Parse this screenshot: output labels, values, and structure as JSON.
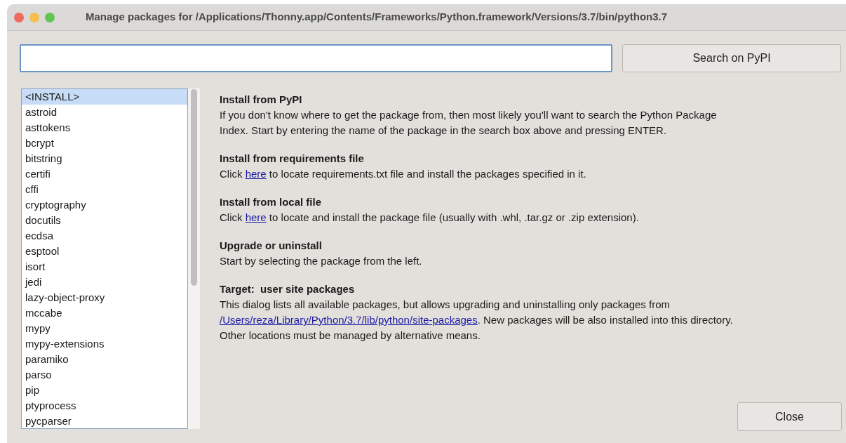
{
  "window": {
    "title": "Manage packages for /Applications/Thonny.app/Contents/Frameworks/Python.framework/Versions/3.7/bin/python3.7"
  },
  "search_button": "Search on PyPI",
  "packages": [
    {
      "label": "<INSTALL>",
      "selected": true
    },
    {
      "label": "astroid",
      "selected": false
    },
    {
      "label": "asttokens",
      "selected": false
    },
    {
      "label": "bcrypt",
      "selected": false
    },
    {
      "label": "bitstring",
      "selected": false
    },
    {
      "label": "certifi",
      "selected": false
    },
    {
      "label": "cffi",
      "selected": false
    },
    {
      "label": "cryptography",
      "selected": false
    },
    {
      "label": "docutils",
      "selected": false
    },
    {
      "label": "ecdsa",
      "selected": false
    },
    {
      "label": "esptool",
      "selected": false
    },
    {
      "label": "isort",
      "selected": false
    },
    {
      "label": "jedi",
      "selected": false
    },
    {
      "label": "lazy-object-proxy",
      "selected": false
    },
    {
      "label": "mccabe",
      "selected": false
    },
    {
      "label": "mypy",
      "selected": false
    },
    {
      "label": "mypy-extensions",
      "selected": false
    },
    {
      "label": "paramiko",
      "selected": false
    },
    {
      "label": "parso",
      "selected": false
    },
    {
      "label": "pip",
      "selected": false
    },
    {
      "label": "ptyprocess",
      "selected": false
    },
    {
      "label": "pycparser",
      "selected": false
    }
  ],
  "sections": [
    {
      "heading": "Install from PyPI",
      "lines": [
        [
          {
            "kind": "text",
            "text": "If you don't know where to get the package from, then most likely you'll want to search the Python Package"
          }
        ],
        [
          {
            "kind": "text",
            "text": "Index. Start by entering the name of the package in the search box above and pressing ENTER."
          }
        ]
      ]
    },
    {
      "heading": "Install from requirements file",
      "lines": [
        [
          {
            "kind": "text",
            "text": "Click "
          },
          {
            "kind": "link",
            "text": "here"
          },
          {
            "kind": "text",
            "text": " to locate requirements.txt file and install the packages specified in it."
          }
        ]
      ]
    },
    {
      "heading": "Install from local file",
      "lines": [
        [
          {
            "kind": "text",
            "text": "Click "
          },
          {
            "kind": "link",
            "text": "here"
          },
          {
            "kind": "text",
            "text": " to locate and install the package file (usually with .whl, .tar.gz or .zip extension)."
          }
        ]
      ]
    },
    {
      "heading": "Upgrade or uninstall",
      "lines": [
        [
          {
            "kind": "text",
            "text": "Start by selecting the package from the left."
          }
        ]
      ]
    },
    {
      "heading": "Target:  user site packages",
      "lines": [
        [
          {
            "kind": "text",
            "text": "This dialog lists all available packages, but allows upgrading and uninstalling only packages from"
          }
        ],
        [
          {
            "kind": "link",
            "text": "/Users/reza/Library/Python/3.7/lib/python/site-packages"
          },
          {
            "kind": "text",
            "text": ". New packages will be also installed into this directory."
          }
        ],
        [
          {
            "kind": "text",
            "text": "Other locations must be managed by alternative means."
          }
        ]
      ]
    }
  ],
  "close_button": "Close"
}
